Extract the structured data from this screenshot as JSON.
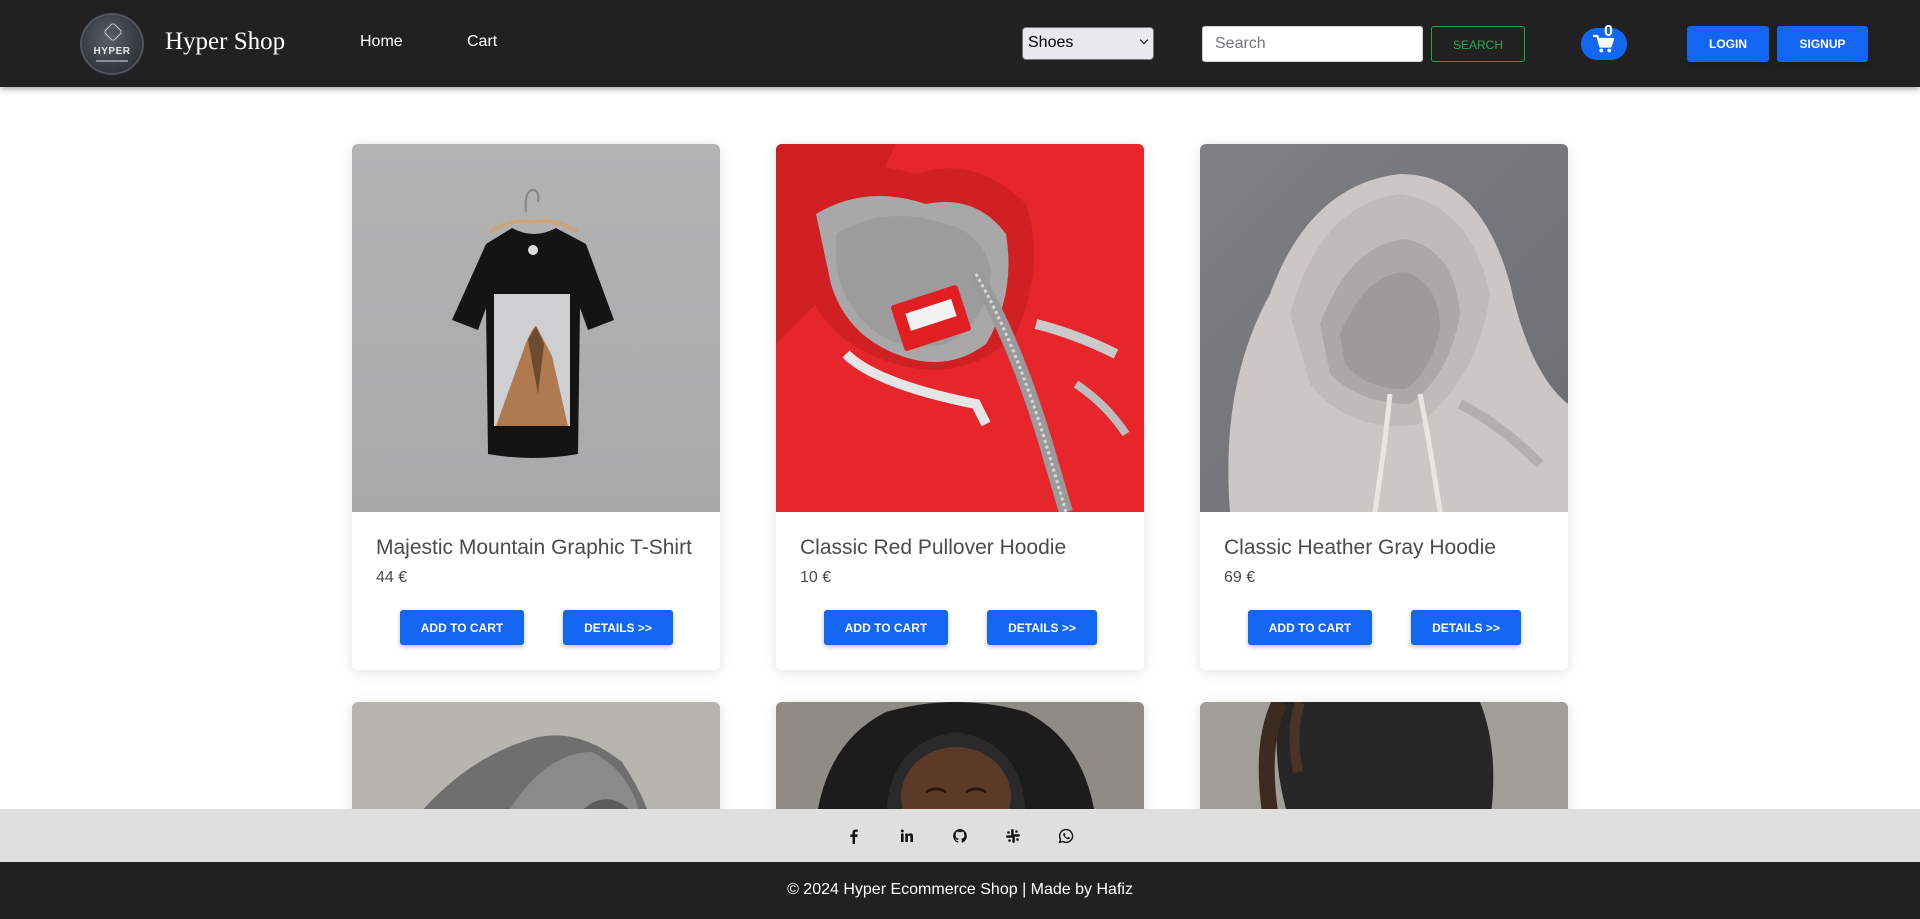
{
  "brand": {
    "logo_text": "HYPER",
    "name": "Hyper Shop"
  },
  "nav": {
    "home": "Home",
    "cart": "Cart"
  },
  "filter": {
    "selected": "Shoes"
  },
  "search": {
    "placeholder": "Search",
    "button": "SEARCH"
  },
  "cart_badge": {
    "count": "0",
    "icon": "shopping-cart-icon"
  },
  "auth": {
    "login": "LOGIN",
    "signup": "SIGNUP"
  },
  "products": [
    {
      "title": "Majestic Mountain Graphic T-Shirt",
      "price": "44 €",
      "add_label": "ADD TO CART",
      "details_label": "DETAILS >>"
    },
    {
      "title": "Classic Red Pullover Hoodie",
      "price": "10 €",
      "add_label": "ADD TO CART",
      "details_label": "DETAILS >>"
    },
    {
      "title": "Classic Heather Gray Hoodie",
      "price": "69 €",
      "add_label": "ADD TO CART",
      "details_label": "DETAILS >>"
    }
  ],
  "social": [
    "facebook-icon",
    "linkedin-icon",
    "github-icon",
    "slack-icon",
    "whatsapp-icon"
  ],
  "footer": {
    "text": "© 2024 Hyper Ecommerce Shop | Made by Hafiz"
  },
  "colors": {
    "navbar": "#212121",
    "primary": "#1266f1",
    "search_outline": "#1ea34a",
    "social_bar": "#dfe0dc"
  }
}
